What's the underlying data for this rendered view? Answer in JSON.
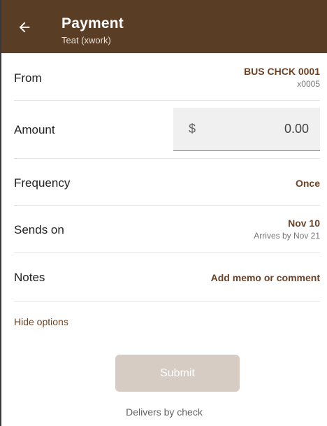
{
  "header": {
    "title": "Payment",
    "subtitle": "Teat (xwork)",
    "background": "#5a3d25"
  },
  "form": {
    "from": {
      "label": "From",
      "account": "BUS CHCK 0001",
      "account_sub": "x0005"
    },
    "amount": {
      "label": "Amount",
      "currency": "$",
      "value": "0.00"
    },
    "frequency": {
      "label": "Frequency",
      "value": "Once"
    },
    "sends_on": {
      "label": "Sends on",
      "date": "Nov 10",
      "arrives": "Arrives by Nov 21"
    },
    "notes": {
      "label": "Notes",
      "placeholder": "Add memo or comment"
    }
  },
  "hide_options": "Hide options",
  "submit_label": "Submit",
  "delivers_text": "Delivers by check",
  "accent_color": "#6b4226",
  "icons": {
    "back": "arrow-left-icon"
  }
}
